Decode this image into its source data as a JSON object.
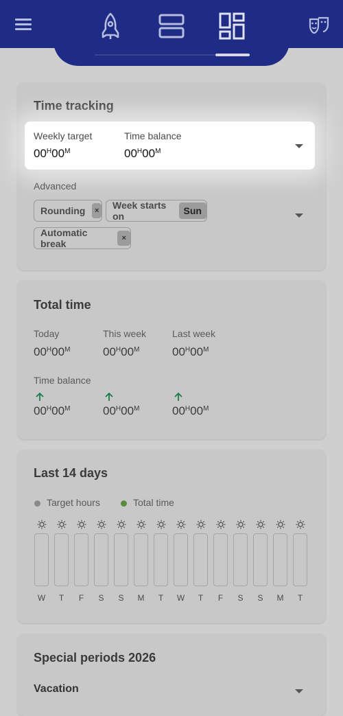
{
  "nav": {
    "menu_icon": "hamburger-menu-icon",
    "tabs": [
      {
        "icon": "rocket-icon"
      },
      {
        "icon": "list-view-icon"
      },
      {
        "icon": "dashboard-grid-icon",
        "selected": true
      }
    ],
    "right_icon": "theater-masks-icon"
  },
  "time_tracking": {
    "title": "Time tracking",
    "weekly_target_label": "Weekly target",
    "weekly_target_h": "00",
    "weekly_target_m": "00",
    "time_balance_label": "Time balance",
    "time_balance_h": "00",
    "time_balance_m": "00",
    "advanced_label": "Advanced",
    "chips": {
      "rounding": "Rounding",
      "week_starts_on": "Week starts on",
      "week_starts_value": "Sun",
      "automatic_break": "Automatic break",
      "remove": "×"
    }
  },
  "total_time": {
    "title": "Total time",
    "today_label": "Today",
    "this_week_label": "This week",
    "last_week_label": "Last week",
    "time_balance_label": "Time balance",
    "h": "00",
    "m": "00",
    "hour_unit": "H",
    "minute_unit": "M",
    "trend_color": "#1e7a4a"
  },
  "last_14_days": {
    "title": "Last 14 days",
    "legend": [
      {
        "label": "Target hours",
        "color": "#8a8a8a"
      },
      {
        "label": "Total time",
        "color": "#5a8a3a"
      }
    ],
    "days": [
      "W",
      "T",
      "F",
      "S",
      "S",
      "M",
      "T",
      "W",
      "T",
      "F",
      "S",
      "S",
      "M",
      "T"
    ]
  },
  "special_periods": {
    "title": "Special periods 2026",
    "vacation_label": "Vacation"
  }
}
